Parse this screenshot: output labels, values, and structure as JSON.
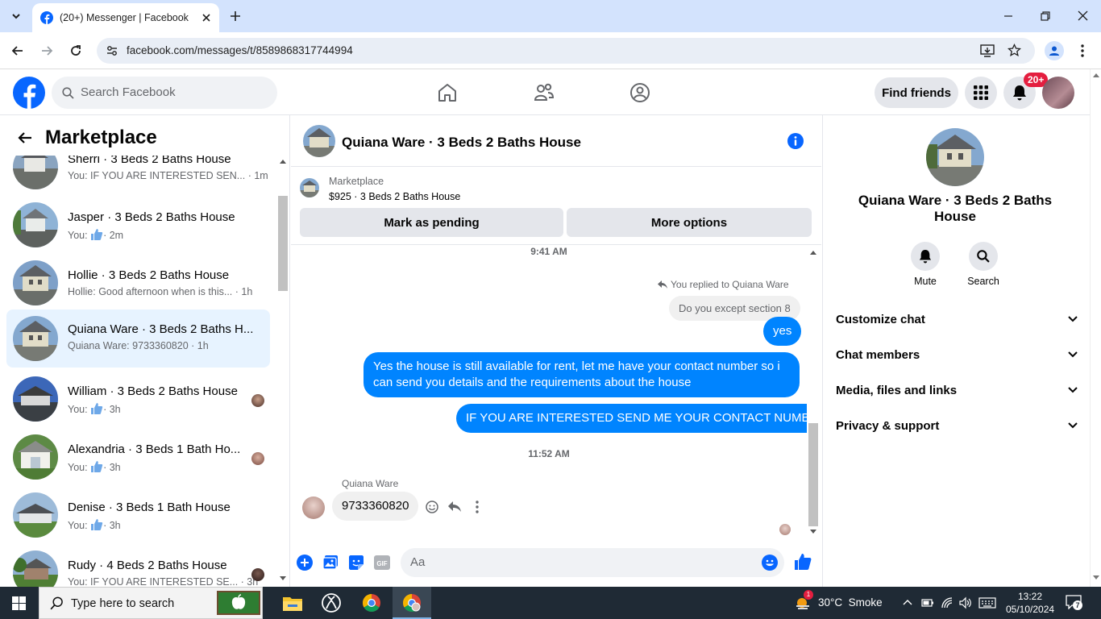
{
  "browser": {
    "tab_title": "(20+) Messenger | Facebook",
    "url": "facebook.com/messages/t/8589868317744994"
  },
  "header": {
    "search_placeholder": "Search Facebook",
    "find_friends": "Find friends",
    "notification_badge": "20+"
  },
  "sidebar": {
    "title": "Marketplace",
    "conversations": [
      {
        "name": "Sherri · 3 Beds 2 Baths House",
        "preview": "You: IF YOU ARE INTERESTED SEN...",
        "time": "· 1m",
        "active": false
      },
      {
        "name": "Jasper · 3 Beds 2 Baths House",
        "preview": "You:",
        "time": "· 2m",
        "active": false
      },
      {
        "name": "Hollie · 3 Beds 2 Baths House",
        "preview": "Hollie: Good afternoon when is this...",
        "time": "· 1h",
        "active": false
      },
      {
        "name": "Quiana Ware · 3 Beds 2 Baths H...",
        "preview": "Quiana Ware: 9733360820",
        "time": "· 1h",
        "active": true
      },
      {
        "name": "William · 3 Beds 2 Baths House",
        "preview": "You:",
        "time": "· 3h",
        "active": false
      },
      {
        "name": "Alexandria · 3 Beds 1 Bath Ho...",
        "preview": "You:",
        "time": "· 3h",
        "active": false
      },
      {
        "name": "Denise · 3 Beds 1 Bath House",
        "preview": "You:",
        "time": "· 3h",
        "active": false
      },
      {
        "name": "Rudy · 4 Beds 2 Baths House",
        "preview": "You: IF YOU ARE INTERESTED SE...",
        "time": "· 3h",
        "active": false
      }
    ]
  },
  "chat": {
    "title": "Quiana Ware · 3 Beds 2 Baths House",
    "listing_source": "Marketplace",
    "listing_price": "$925 · 3 Beds 2 Baths House",
    "mark_pending": "Mark as pending",
    "more_options": "More options",
    "time1": "9:41 AM",
    "replied_label": "You replied to Quiana Ware",
    "quoted_msg": "Do you except section 8",
    "msg_yes": "yes",
    "msg_long": "Yes the house is still available for rent, let me have your contact number so i can send you details and the requirements about the house",
    "msg_caps": "IF YOU ARE INTERESTED SEND ME YOUR CONTACT NUMBER",
    "time2": "11:52 AM",
    "sender_name": "Quiana Ware",
    "incoming_msg": "9733360820",
    "composer_placeholder": "Aa"
  },
  "details": {
    "name": "Quiana Ware · 3 Beds 2 Baths House",
    "mute": "Mute",
    "search": "Search",
    "sections": [
      "Customize chat",
      "Chat members",
      "Media, files and links",
      "Privacy & support"
    ]
  },
  "taskbar": {
    "search_placeholder": "Type here to search",
    "weather": "30°C  Smoke",
    "time": "13:22",
    "date": "05/10/2024",
    "weather_badge": "1",
    "notif_count": "7"
  },
  "colors": {
    "accent": "#0084ff",
    "fb_blue": "#0866ff",
    "badge_red": "#e41e3f"
  }
}
